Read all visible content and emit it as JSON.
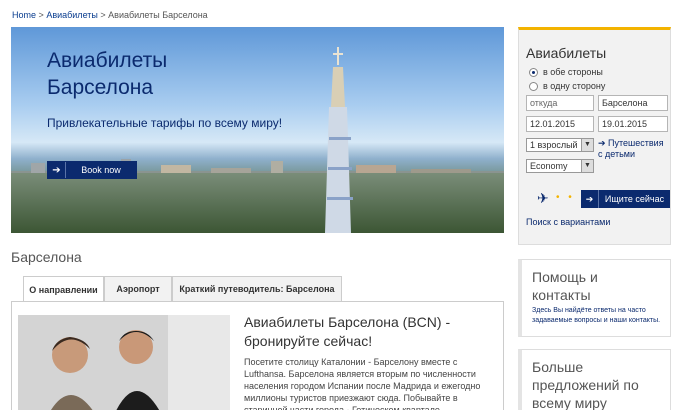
{
  "breadcrumb": {
    "home": "Home",
    "sep1": ">",
    "level1": "Авиабилеты",
    "sep2": ">",
    "current": "Авиабилеты Барселона"
  },
  "hero": {
    "title_line1": "Авиабилеты",
    "title_line2": "Барселона",
    "tagline": "Привлекательные тарифы по всему миру!",
    "book_label": "Book now"
  },
  "search": {
    "title": "Авиабилеты",
    "trip_roundtrip": "в обе стороны",
    "trip_oneway": "в одну сторону",
    "from_placeholder": "откуда",
    "to_value": "Барселона",
    "depart_date": "12.01.2015",
    "return_date": "19.01.2015",
    "passengers": "1 взрослый",
    "cabin": "Economy",
    "kids_link": "Путешествия с детьми",
    "search_button": "Ищите сейчас",
    "variants_link": "Поиск с вариантами"
  },
  "help": {
    "title_line1": "Помощь и",
    "title_line2": "контакты",
    "text": "Здесь Вы найдёте ответы на часто задаваемые вопросы и наши контакты."
  },
  "more": {
    "title": "Больше предложений по всему миру"
  },
  "section": {
    "title": "Барселона",
    "tabs": [
      "О направлении",
      "Аэропорт",
      "Краткий путеводитель: Барселона"
    ]
  },
  "article": {
    "title": "Авиабилеты Барселона (BCN) - бронируйте сейчас!",
    "text": "Посетите столицу Каталонии - Барселону вместе с Lufthansa. Барселона является вторым по численности населения городом Испании после Мадрида и ежегодно миллионы туристов приезжают сюда. Побывайте в старинной части города - Готическом квартале, полюбуйтесь на шедевры Гауди."
  },
  "colors": {
    "brand": "#0b2a6e",
    "accent": "#f3b300"
  }
}
